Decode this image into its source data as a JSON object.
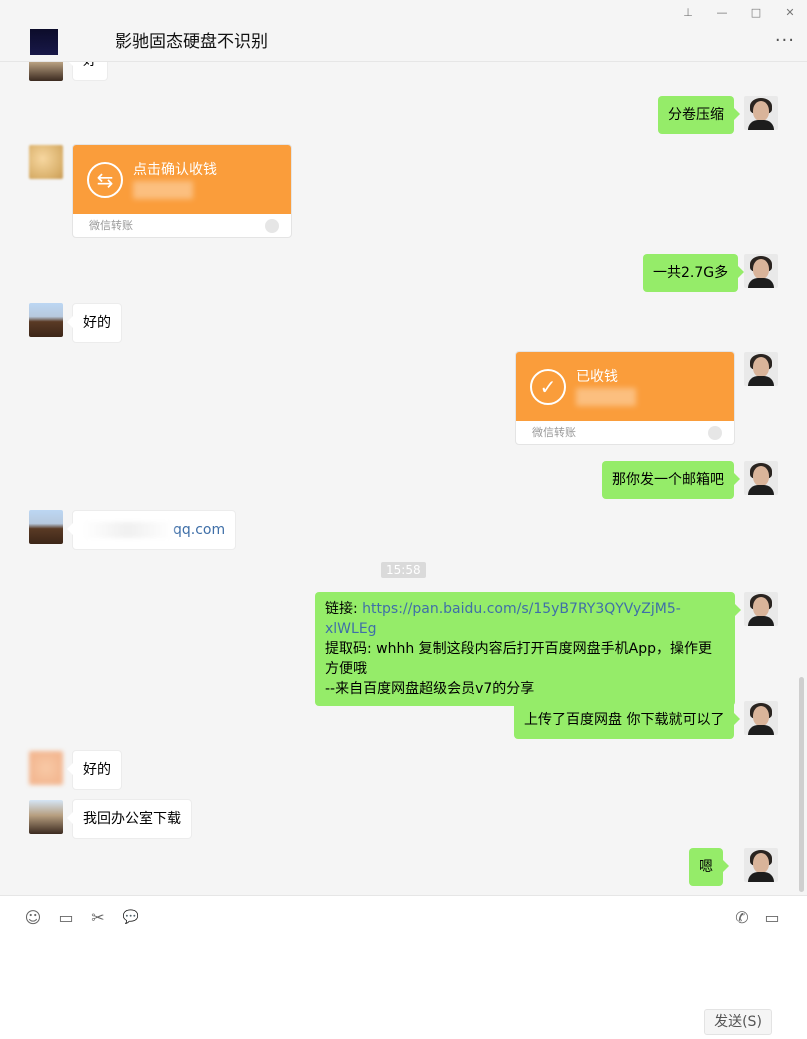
{
  "window": {
    "title": "影驰固态硬盘不识别",
    "buttons": {
      "pin": "⊥",
      "minimize": "—",
      "maximize": "□",
      "close": "✕"
    },
    "more": "···"
  },
  "messages": [
    {
      "side": "in",
      "text": "好"
    },
    {
      "side": "out",
      "text": "分卷压缩"
    },
    {
      "side": "in",
      "type": "transfer",
      "label": "点击确认收钱",
      "footer": "微信转账",
      "icon": "transfer-arrows-icon"
    },
    {
      "side": "out",
      "text": "一共2.7G多"
    },
    {
      "side": "in",
      "text": "好的"
    },
    {
      "side": "out",
      "type": "transfer",
      "label": "已收钱",
      "footer": "微信转账",
      "icon": "checkmark-icon"
    },
    {
      "side": "out",
      "text": "那你发一个邮箱吧"
    },
    {
      "side": "in",
      "text": "qq.com"
    },
    {
      "side": "out",
      "type": "link",
      "link_label": "链接: ",
      "link": "https://pan.baidu.com/s/15yB7RY3QYVyZjM5-xlWLEg",
      "line2": "提取码: whhh 复制这段内容后打开百度网盘手机App，操作更方便哦",
      "line3": "--来自百度网盘超级会员v7的分享"
    },
    {
      "side": "out",
      "text": "上传了百度网盘 你下载就可以了"
    },
    {
      "side": "in",
      "text": "好的"
    },
    {
      "side": "in",
      "text": "我回办公室下载"
    },
    {
      "side": "out",
      "text": "嗯"
    }
  ],
  "timestamp": "15:58",
  "toolbar": {
    "emoji": "☺",
    "folder": "▭",
    "scissors": "✂",
    "chat": "💬",
    "phone": "✆",
    "video": "▭"
  },
  "send_label": "发送(S)",
  "colors": {
    "outgoing": "#95ec69",
    "incoming": "#ffffff",
    "transfer": "#fa9d3b",
    "background": "#f5f5f5"
  }
}
